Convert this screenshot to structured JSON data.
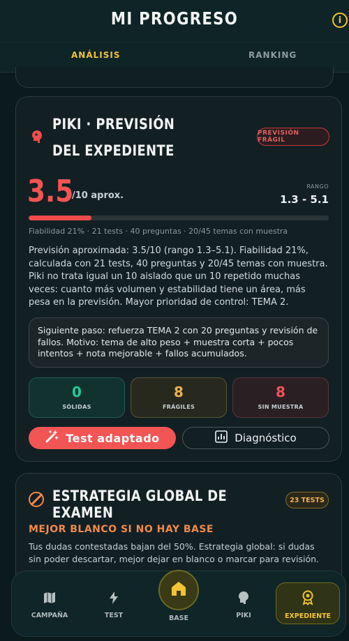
{
  "header": {
    "title": "MI PROGRESO",
    "info_icon": "i",
    "tabs": [
      {
        "label": "ANÁLISIS",
        "active": true
      },
      {
        "label": "RANKING",
        "active": false
      }
    ]
  },
  "piki_card": {
    "title": "PIKI · PREVISIÓN DEL EXPEDIENTE",
    "badge": "PREVISIÓN FRÁGIL",
    "score": "3.5",
    "score_suffix": "/10 aprox.",
    "range_label": "RANGO",
    "range_value": "1.3 - 5.1",
    "reliability_fraction": 0.21,
    "stats_line": "Fiabilidad 21% · 21 tests · 40 preguntas · 20/45 temas con muestra",
    "description": "Previsión aproximada: 3.5/10 (rango 1.3–5.1). Fiabilidad 21%, calculada con 21 tests, 40 preguntas y 20/45 temas con muestra. Piki no trata igual un 10 aislado que un 10 repetido muchas veces: cuanto más volumen y estabilidad tiene un área, más pesa en la previsión. Mayor prioridad de control: TEMA 2.",
    "next_step": "Siguiente paso: refuerza TEMA 2 con 20 preguntas y revisión de fallos. Motivo: tema de alto peso + muestra corta + pocos intentos + nota mejorable + fallos acumulados.",
    "stats": {
      "solidas": {
        "value": "0",
        "label": "SÓLIDAS"
      },
      "fragiles": {
        "value": "8",
        "label": "FRÁGILES"
      },
      "sin_muestra": {
        "value": "8",
        "label": "SIN MUESTRA"
      }
    },
    "buttons": {
      "test": "Test adaptado",
      "diagnostico": "Diagnóstico"
    },
    "colors": {
      "accent": "#f24b4b",
      "solid": "#22c79a",
      "fragile": "#f0b04a"
    }
  },
  "strategy_card": {
    "title": "ESTRATEGIA GLOBAL DE EXAMEN",
    "badge": "23 TESTS",
    "subtitle": "MEJOR BLANCO SI NO HAY BASE",
    "description": "Tus dudas contestadas bajan del 50%. Estrategia global: si dudas sin poder descartar, mejor dejar en blanco o marcar para revisión."
  },
  "bottom_nav": {
    "items": [
      {
        "label": "CAMPAÑA",
        "icon": "map-icon"
      },
      {
        "label": "TEST",
        "icon": "lightning-icon"
      },
      {
        "label": "BASE",
        "icon": "home-icon"
      },
      {
        "label": "PIKI",
        "icon": "brain-icon"
      },
      {
        "label": "EXPEDIENTE",
        "icon": "medal-icon",
        "active": true
      }
    ]
  }
}
